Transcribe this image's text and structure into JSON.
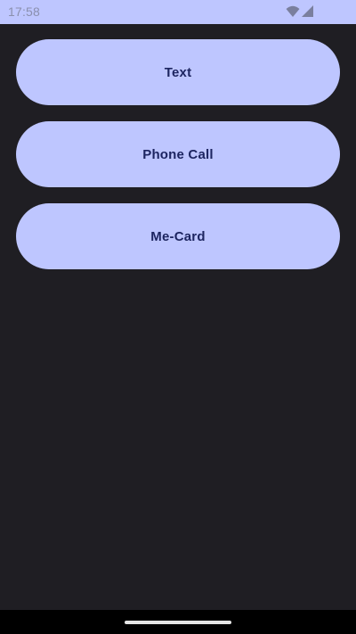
{
  "status_bar": {
    "time": "17:58",
    "icons": [
      "wifi-icon",
      "cell-signal-icon"
    ]
  },
  "actions": [
    {
      "label": "Text"
    },
    {
      "label": "Phone Call"
    },
    {
      "label": "Me-Card"
    }
  ],
  "colors": {
    "accent": "#bec6ff",
    "background": "#1f1e23",
    "button_text": "#1d2560"
  }
}
